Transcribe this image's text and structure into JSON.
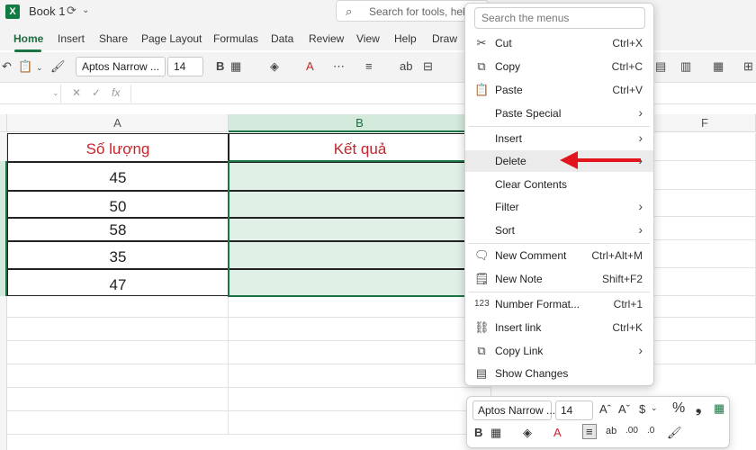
{
  "titlebar": {
    "app_icon": "X",
    "title": "Book 1",
    "search_placeholder": "Search for tools, help"
  },
  "tabs": [
    "Home",
    "Insert",
    "Share",
    "Page Layout",
    "Formulas",
    "Data",
    "Review",
    "View",
    "Help",
    "Draw"
  ],
  "toolbar": {
    "font_name": "Aptos Narrow ...",
    "font_size": "14",
    "bold": "B",
    "font_color_glyph": "A"
  },
  "formula_bar": {
    "fx": "fx"
  },
  "columns": [
    "A",
    "B",
    "F"
  ],
  "table": {
    "header_a": "Số lượng",
    "header_b": "Kết quả",
    "values": [
      "45",
      "50",
      "58",
      "35",
      "47"
    ]
  },
  "context_menu": {
    "search_placeholder": "Search the menus",
    "items": [
      {
        "label": "Cut",
        "shortcut": "Ctrl+X",
        "icon": "scissors-icon"
      },
      {
        "label": "Copy",
        "shortcut": "Ctrl+C",
        "icon": "copy-icon"
      },
      {
        "label": "Paste",
        "shortcut": "Ctrl+V",
        "icon": "paste-icon"
      },
      {
        "label": "Paste Special",
        "shortcut": "",
        "icon": ""
      },
      {
        "label": "Insert",
        "shortcut": "",
        "icon": ""
      },
      {
        "label": "Delete",
        "shortcut": "",
        "icon": ""
      },
      {
        "label": "Clear Contents",
        "shortcut": "",
        "icon": ""
      },
      {
        "label": "Filter",
        "shortcut": "",
        "icon": ""
      },
      {
        "label": "Sort",
        "shortcut": "",
        "icon": ""
      },
      {
        "label": "New Comment",
        "shortcut": "Ctrl+Alt+M",
        "icon": "comment-icon"
      },
      {
        "label": "New Note",
        "shortcut": "Shift+F2",
        "icon": "note-icon"
      },
      {
        "label": "Number Format...",
        "shortcut": "Ctrl+1",
        "icon": "number-format-icon"
      },
      {
        "label": "Insert link",
        "shortcut": "Ctrl+K",
        "icon": "link-icon"
      },
      {
        "label": "Copy Link",
        "shortcut": "",
        "icon": "copy-link-icon"
      },
      {
        "label": "Show Changes",
        "shortcut": "",
        "icon": "show-changes-icon"
      }
    ]
  },
  "mini_toolbar": {
    "font_name": "Aptos Narrow ...",
    "font_size": "14",
    "bold": "B",
    "dollar": "$",
    "percent": "%",
    "comma": "❟"
  },
  "colors": {
    "accent_green": "#1a7343",
    "header_red": "#c0272d",
    "arrow_red": "#e2151c"
  }
}
